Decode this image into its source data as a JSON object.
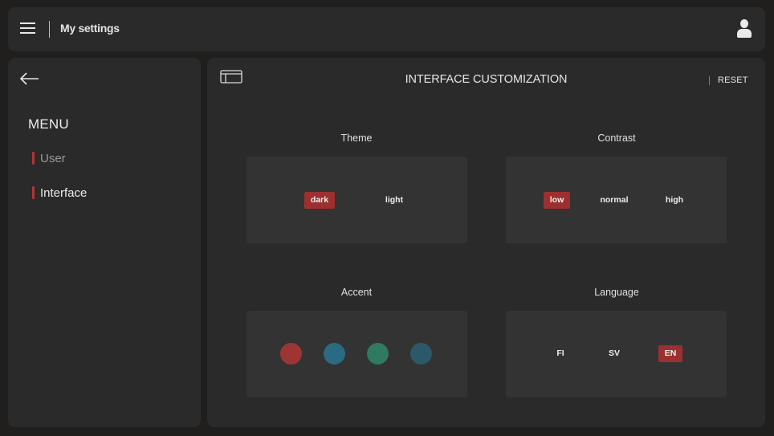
{
  "header": {
    "title": "My settings",
    "menu_icon": "hamburger-menu-icon",
    "user_icon": "user-icon"
  },
  "sidebar": {
    "back_icon": "arrow-left-icon",
    "menu_title": "MENU",
    "items": [
      {
        "label": "User",
        "active": false
      },
      {
        "label": "Interface",
        "active": true
      }
    ]
  },
  "main": {
    "layout_icon": "window-layout-icon",
    "title": "INTERFACE CUSTOMIZATION",
    "reset_label": "RESET",
    "sections": {
      "theme": {
        "label": "Theme",
        "options": [
          {
            "label": "dark",
            "selected": true
          },
          {
            "label": "light",
            "selected": false
          }
        ]
      },
      "contrast": {
        "label": "Contrast",
        "options": [
          {
            "label": "low",
            "selected": true
          },
          {
            "label": "normal",
            "selected": false
          },
          {
            "label": "high",
            "selected": false
          }
        ]
      },
      "accent": {
        "label": "Accent",
        "colors": [
          "#9e3535",
          "#2b6a83",
          "#2f7a60",
          "#2d5868"
        ]
      },
      "language": {
        "label": "Language",
        "options": [
          {
            "label": "FI",
            "selected": false
          },
          {
            "label": "SV",
            "selected": false
          },
          {
            "label": "EN",
            "selected": true
          }
        ]
      }
    }
  },
  "colors": {
    "background": "#211e1e",
    "panel": "#2a2a2a",
    "card": "#333333",
    "accent_active": "#9c2f2f",
    "sidebar_marker": "#b03535",
    "reset_marker": "#2e9e86"
  }
}
